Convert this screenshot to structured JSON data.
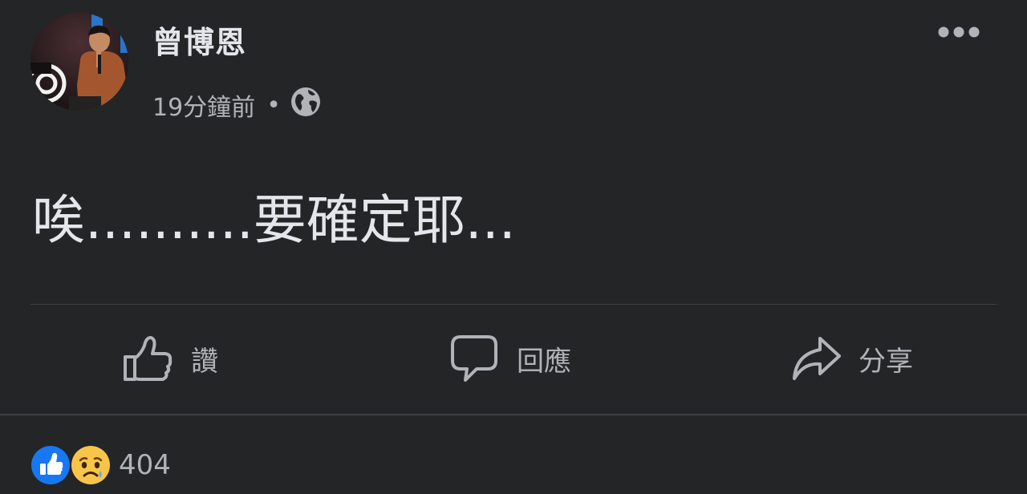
{
  "post": {
    "author_name": "曾博恩",
    "timestamp": "19分鐘前",
    "separator": "•",
    "audience_icon": "globe-icon",
    "more_icon": "more-options-icon",
    "text": "唉..........要確定耶..."
  },
  "actions": {
    "like_label": "讚",
    "comment_label": "回應",
    "share_label": "分享"
  },
  "reactions": {
    "icons": [
      "like-reaction-icon",
      "sad-reaction-icon"
    ],
    "count": "404"
  },
  "colors": {
    "background": "#242526",
    "primary_text": "#e4e6eb",
    "secondary_text": "#b0b3b8",
    "divider": "#3e4042",
    "like_blue": "#1877f2",
    "sad_yellow": "#f7c54a"
  }
}
